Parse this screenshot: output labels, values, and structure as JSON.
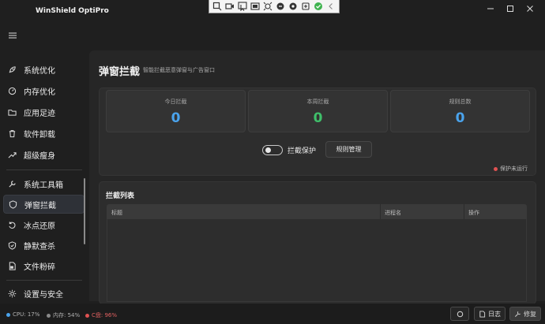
{
  "app": {
    "title": "WinShield OptiPro"
  },
  "sidebar": {
    "items": [
      {
        "label": "系统优化",
        "icon": "rocket-icon"
      },
      {
        "label": "内存优化",
        "icon": "gauge-icon"
      },
      {
        "label": "应用足迹",
        "icon": "folder-icon"
      },
      {
        "label": "软件卸载",
        "icon": "trash-icon"
      },
      {
        "label": "超级瘦身",
        "icon": "trend-icon"
      },
      {
        "label": "系统工具箱",
        "icon": "wrench-icon"
      },
      {
        "label": "弹窗拦截",
        "icon": "shield-icon",
        "active": true
      },
      {
        "label": "冰点还原",
        "icon": "restore-icon"
      },
      {
        "label": "静默查杀",
        "icon": "shield-check-icon"
      },
      {
        "label": "文件粉碎",
        "icon": "file-shred-icon"
      },
      {
        "label": "设置与安全",
        "icon": "gear-icon"
      }
    ]
  },
  "main": {
    "title": "弹窗拦截",
    "subtitle": "智能拦截恶意弹窗与广告窗口",
    "stats": [
      {
        "label": "今日拦截",
        "value": "0",
        "color": "#4aa3ec"
      },
      {
        "label": "本周拦截",
        "value": "0",
        "color": "#3fbf6a"
      },
      {
        "label": "规则总数",
        "value": "0",
        "color": "#4aa3ec"
      }
    ],
    "toggle_label": "拦截保护",
    "rules_button": "规则管理",
    "status_text": "保护未运行",
    "list": {
      "title": "拦截列表",
      "columns": [
        "标题",
        "进程名",
        "操作"
      ]
    }
  },
  "statusbar": {
    "cpu": "CPU: 17%",
    "mem": "内存: 54%",
    "disk": "C盘: 96%",
    "log_button": "日志",
    "repair_button": "修复"
  },
  "colors": {
    "accent": "#4aa3ec",
    "success": "#3fbf6a",
    "danger": "#e05252"
  }
}
